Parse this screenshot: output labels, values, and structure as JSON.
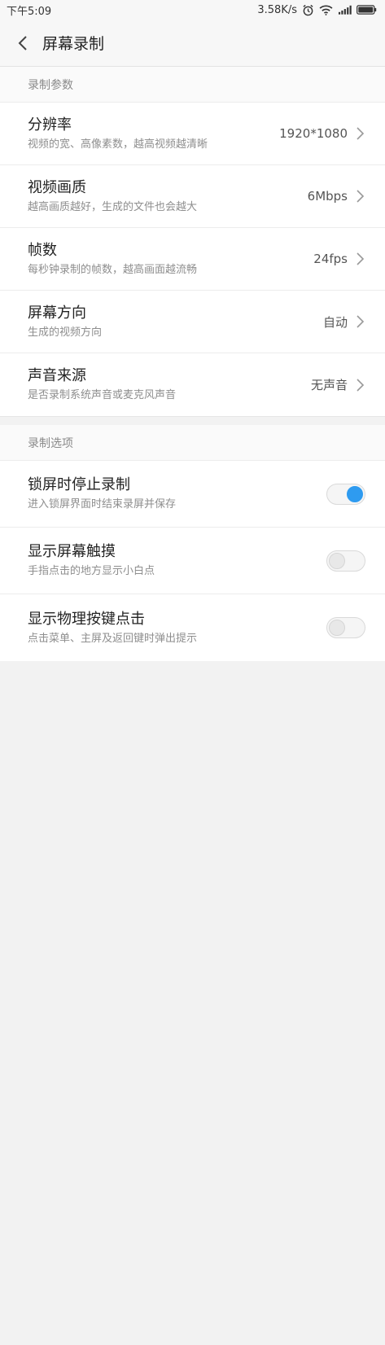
{
  "status_bar": {
    "time": "下午5:09",
    "network_speed": "3.58K/s",
    "icons": [
      "alarm-icon",
      "wifi-icon",
      "signal-icon",
      "battery-icon"
    ]
  },
  "header": {
    "title": "屏幕录制"
  },
  "sections": {
    "params": {
      "label": "录制参数",
      "rows": [
        {
          "title": "分辨率",
          "subtitle": "视频的宽、高像素数，越高视频越清晰",
          "value": "1920*1080"
        },
        {
          "title": "视频画质",
          "subtitle": "越高画质越好，生成的文件也会越大",
          "value": "6Mbps"
        },
        {
          "title": "帧数",
          "subtitle": "每秒钟录制的帧数，越高画面越流畅",
          "value": "24fps"
        },
        {
          "title": "屏幕方向",
          "subtitle": "生成的视频方向",
          "value": "自动"
        },
        {
          "title": "声音来源",
          "subtitle": "是否录制系统声音或麦克风声音",
          "value": "无声音"
        }
      ]
    },
    "options": {
      "label": "录制选项",
      "rows": [
        {
          "title": "锁屏时停止录制",
          "subtitle": "进入锁屏界面时结束录屏并保存",
          "enabled": true
        },
        {
          "title": "显示屏幕触摸",
          "subtitle": "手指点击的地方显示小白点",
          "enabled": false
        },
        {
          "title": "显示物理按键点击",
          "subtitle": "点击菜单、主屏及返回键时弹出提示",
          "enabled": false
        }
      ]
    }
  },
  "colors": {
    "accent": "#2e9bf0",
    "background": "#f7f7f7"
  }
}
